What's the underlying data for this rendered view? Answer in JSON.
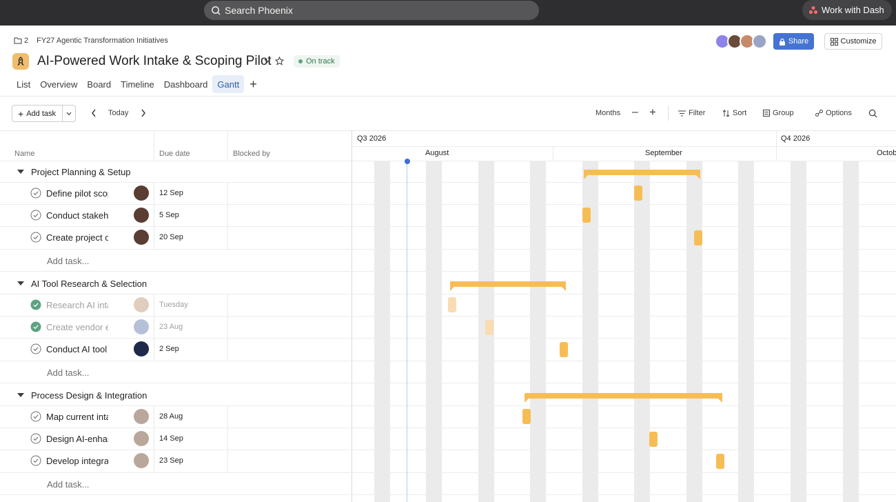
{
  "topbar": {
    "search_placeholder": "Search Phoenix",
    "dash_label": "Work with Dash"
  },
  "breadcrumb": {
    "count": "2",
    "portfolio": "FY27 Agentic Transformation Initiatives"
  },
  "project": {
    "title": "AI-Powered Work Intake & Scoping Pilot",
    "status": "On track",
    "accent_color": "#f1bd6c"
  },
  "tabs": [
    {
      "label": "List"
    },
    {
      "label": "Overview"
    },
    {
      "label": "Board"
    },
    {
      "label": "Timeline"
    },
    {
      "label": "Dashboard"
    },
    {
      "label": "Gantt",
      "active": true
    }
  ],
  "header_actions": {
    "share": "Share",
    "customize": "Customize"
  },
  "toolbar": {
    "add_task": "Add task",
    "today": "Today",
    "zoom": "Months",
    "filter": "Filter",
    "sort": "Sort",
    "group": "Group",
    "options": "Options"
  },
  "columns": {
    "name": "Name",
    "due": "Due date",
    "blocked": "Blocked by"
  },
  "timeline": {
    "q3": "Q3 2026",
    "q4": "Q4 2026",
    "m1": "August",
    "m2": "September",
    "m3": "October"
  },
  "add_task_label": "Add task...",
  "sections": [
    {
      "name": "Project Planning & Setup",
      "tasks": [
        {
          "name": "Define pilot scope",
          "due": "12 Sep",
          "done": false
        },
        {
          "name": "Conduct stakeholder interviews",
          "due": "5 Sep",
          "done": false
        },
        {
          "name": "Create project charter",
          "due": "20 Sep",
          "done": false
        }
      ]
    },
    {
      "name": "AI Tool Research & Selection",
      "tasks": [
        {
          "name": "Research AI intake tools",
          "due": "Tuesday",
          "done": true
        },
        {
          "name": "Create vendor evaluation",
          "due": "23 Aug",
          "done": true
        },
        {
          "name": "Conduct AI tool demos",
          "due": "2 Sep",
          "done": false
        }
      ]
    },
    {
      "name": "Process Design & Integration",
      "tasks": [
        {
          "name": "Map current intake process",
          "due": "28 Aug",
          "done": false
        },
        {
          "name": "Design AI-enhanced workflow",
          "due": "14 Sep",
          "done": false
        },
        {
          "name": "Develop integration plan",
          "due": "23 Sep",
          "done": false
        }
      ]
    }
  ]
}
